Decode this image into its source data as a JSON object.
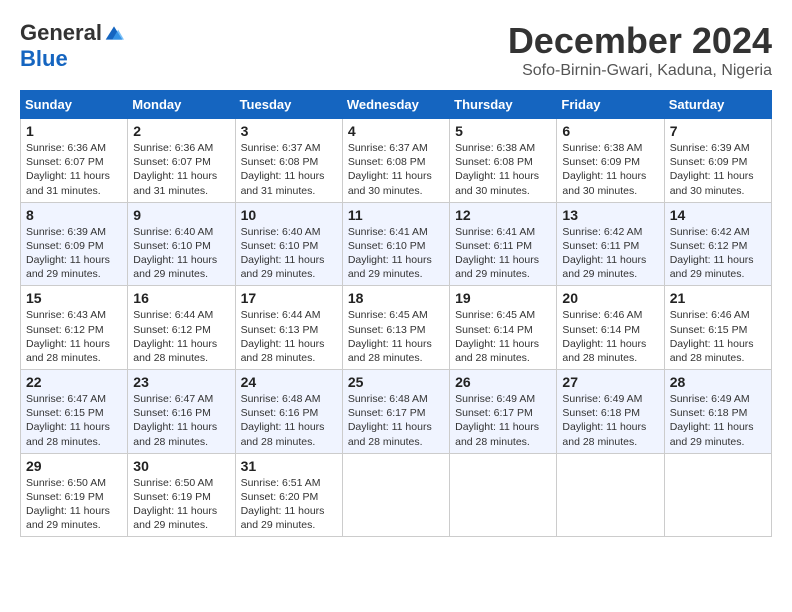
{
  "logo": {
    "general": "General",
    "blue": "Blue"
  },
  "title": "December 2024",
  "location": "Sofo-Birnin-Gwari, Kaduna, Nigeria",
  "days_of_week": [
    "Sunday",
    "Monday",
    "Tuesday",
    "Wednesday",
    "Thursday",
    "Friday",
    "Saturday"
  ],
  "weeks": [
    [
      {
        "day": "1",
        "sunrise": "6:36 AM",
        "sunset": "6:07 PM",
        "daylight": "11 hours and 31 minutes."
      },
      {
        "day": "2",
        "sunrise": "6:36 AM",
        "sunset": "6:07 PM",
        "daylight": "11 hours and 31 minutes."
      },
      {
        "day": "3",
        "sunrise": "6:37 AM",
        "sunset": "6:08 PM",
        "daylight": "11 hours and 31 minutes."
      },
      {
        "day": "4",
        "sunrise": "6:37 AM",
        "sunset": "6:08 PM",
        "daylight": "11 hours and 30 minutes."
      },
      {
        "day": "5",
        "sunrise": "6:38 AM",
        "sunset": "6:08 PM",
        "daylight": "11 hours and 30 minutes."
      },
      {
        "day": "6",
        "sunrise": "6:38 AM",
        "sunset": "6:09 PM",
        "daylight": "11 hours and 30 minutes."
      },
      {
        "day": "7",
        "sunrise": "6:39 AM",
        "sunset": "6:09 PM",
        "daylight": "11 hours and 30 minutes."
      }
    ],
    [
      {
        "day": "8",
        "sunrise": "6:39 AM",
        "sunset": "6:09 PM",
        "daylight": "11 hours and 29 minutes."
      },
      {
        "day": "9",
        "sunrise": "6:40 AM",
        "sunset": "6:10 PM",
        "daylight": "11 hours and 29 minutes."
      },
      {
        "day": "10",
        "sunrise": "6:40 AM",
        "sunset": "6:10 PM",
        "daylight": "11 hours and 29 minutes."
      },
      {
        "day": "11",
        "sunrise": "6:41 AM",
        "sunset": "6:10 PM",
        "daylight": "11 hours and 29 minutes."
      },
      {
        "day": "12",
        "sunrise": "6:41 AM",
        "sunset": "6:11 PM",
        "daylight": "11 hours and 29 minutes."
      },
      {
        "day": "13",
        "sunrise": "6:42 AM",
        "sunset": "6:11 PM",
        "daylight": "11 hours and 29 minutes."
      },
      {
        "day": "14",
        "sunrise": "6:42 AM",
        "sunset": "6:12 PM",
        "daylight": "11 hours and 29 minutes."
      }
    ],
    [
      {
        "day": "15",
        "sunrise": "6:43 AM",
        "sunset": "6:12 PM",
        "daylight": "11 hours and 28 minutes."
      },
      {
        "day": "16",
        "sunrise": "6:44 AM",
        "sunset": "6:12 PM",
        "daylight": "11 hours and 28 minutes."
      },
      {
        "day": "17",
        "sunrise": "6:44 AM",
        "sunset": "6:13 PM",
        "daylight": "11 hours and 28 minutes."
      },
      {
        "day": "18",
        "sunrise": "6:45 AM",
        "sunset": "6:13 PM",
        "daylight": "11 hours and 28 minutes."
      },
      {
        "day": "19",
        "sunrise": "6:45 AM",
        "sunset": "6:14 PM",
        "daylight": "11 hours and 28 minutes."
      },
      {
        "day": "20",
        "sunrise": "6:46 AM",
        "sunset": "6:14 PM",
        "daylight": "11 hours and 28 minutes."
      },
      {
        "day": "21",
        "sunrise": "6:46 AM",
        "sunset": "6:15 PM",
        "daylight": "11 hours and 28 minutes."
      }
    ],
    [
      {
        "day": "22",
        "sunrise": "6:47 AM",
        "sunset": "6:15 PM",
        "daylight": "11 hours and 28 minutes."
      },
      {
        "day": "23",
        "sunrise": "6:47 AM",
        "sunset": "6:16 PM",
        "daylight": "11 hours and 28 minutes."
      },
      {
        "day": "24",
        "sunrise": "6:48 AM",
        "sunset": "6:16 PM",
        "daylight": "11 hours and 28 minutes."
      },
      {
        "day": "25",
        "sunrise": "6:48 AM",
        "sunset": "6:17 PM",
        "daylight": "11 hours and 28 minutes."
      },
      {
        "day": "26",
        "sunrise": "6:49 AM",
        "sunset": "6:17 PM",
        "daylight": "11 hours and 28 minutes."
      },
      {
        "day": "27",
        "sunrise": "6:49 AM",
        "sunset": "6:18 PM",
        "daylight": "11 hours and 28 minutes."
      },
      {
        "day": "28",
        "sunrise": "6:49 AM",
        "sunset": "6:18 PM",
        "daylight": "11 hours and 29 minutes."
      }
    ],
    [
      {
        "day": "29",
        "sunrise": "6:50 AM",
        "sunset": "6:19 PM",
        "daylight": "11 hours and 29 minutes."
      },
      {
        "day": "30",
        "sunrise": "6:50 AM",
        "sunset": "6:19 PM",
        "daylight": "11 hours and 29 minutes."
      },
      {
        "day": "31",
        "sunrise": "6:51 AM",
        "sunset": "6:20 PM",
        "daylight": "11 hours and 29 minutes."
      },
      null,
      null,
      null,
      null
    ]
  ],
  "labels": {
    "sunrise": "Sunrise:",
    "sunset": "Sunset:",
    "daylight": "Daylight:"
  }
}
